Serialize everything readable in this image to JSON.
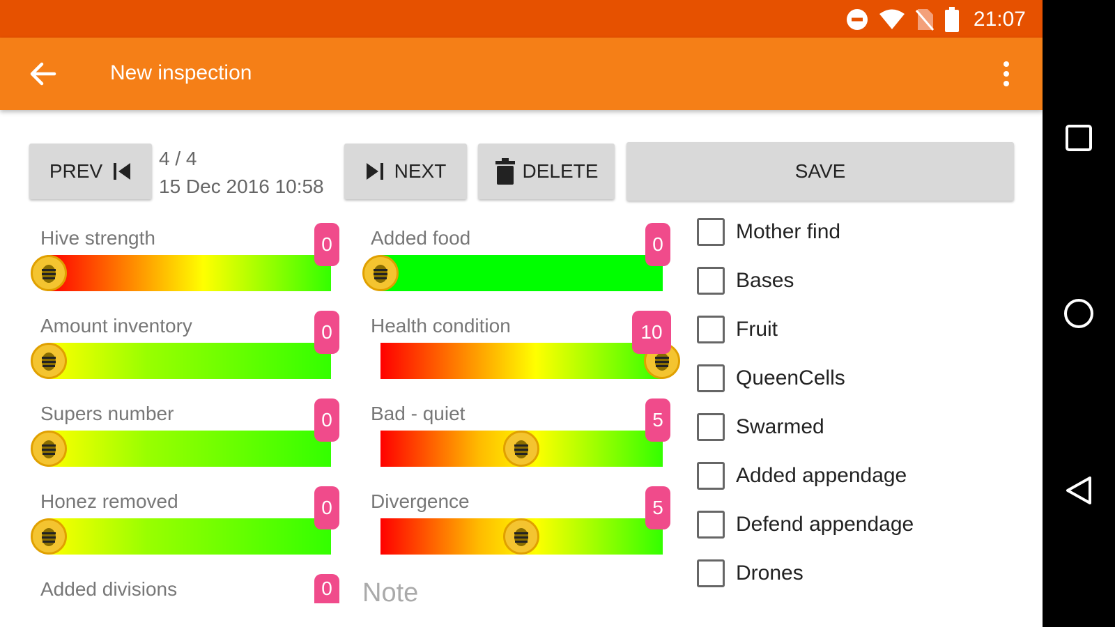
{
  "status_bar": {
    "time": "21:07",
    "icons": [
      "do-not-disturb-icon",
      "wifi-icon",
      "no-sim-icon",
      "battery-icon"
    ]
  },
  "toolbar": {
    "title": "New inspection",
    "back_icon": "arrow-back-icon",
    "menu_icon": "more-vert-icon"
  },
  "controls": {
    "prev_label": "PREV",
    "counter": "4 / 4",
    "date": "15 Dec 2016 10:58",
    "next_label": "NEXT",
    "delete_label": "DELETE",
    "save_label": "SAVE"
  },
  "sliders_left": [
    {
      "label": "Hive strength",
      "value": "0"
    },
    {
      "label": "Amount inventory",
      "value": "0"
    },
    {
      "label": "Supers number",
      "value": "0"
    },
    {
      "label": "Honez removed",
      "value": "0"
    },
    {
      "label": "Added divisions",
      "value": "0"
    }
  ],
  "sliders_right": [
    {
      "label": "Added food",
      "value": "0"
    },
    {
      "label": "Health condition",
      "value": "10"
    },
    {
      "label": "Bad - quiet",
      "value": "5"
    },
    {
      "label": "Divergence",
      "value": "5"
    }
  ],
  "checkboxes": [
    {
      "label": "Mother find",
      "checked": false
    },
    {
      "label": "Bases",
      "checked": false
    },
    {
      "label": "Fruit",
      "checked": false
    },
    {
      "label": "QueenCells",
      "checked": false
    },
    {
      "label": "Swarmed",
      "checked": false
    },
    {
      "label": "Added appendage",
      "checked": false
    },
    {
      "label": "Defend appendage",
      "checked": false
    },
    {
      "label": "Drones",
      "checked": false
    }
  ],
  "note_placeholder": "Note",
  "colors": {
    "status_bar": "#e65100",
    "toolbar": "#f57f17",
    "badge": "#f04b8b",
    "thumb": "#f4c430"
  }
}
